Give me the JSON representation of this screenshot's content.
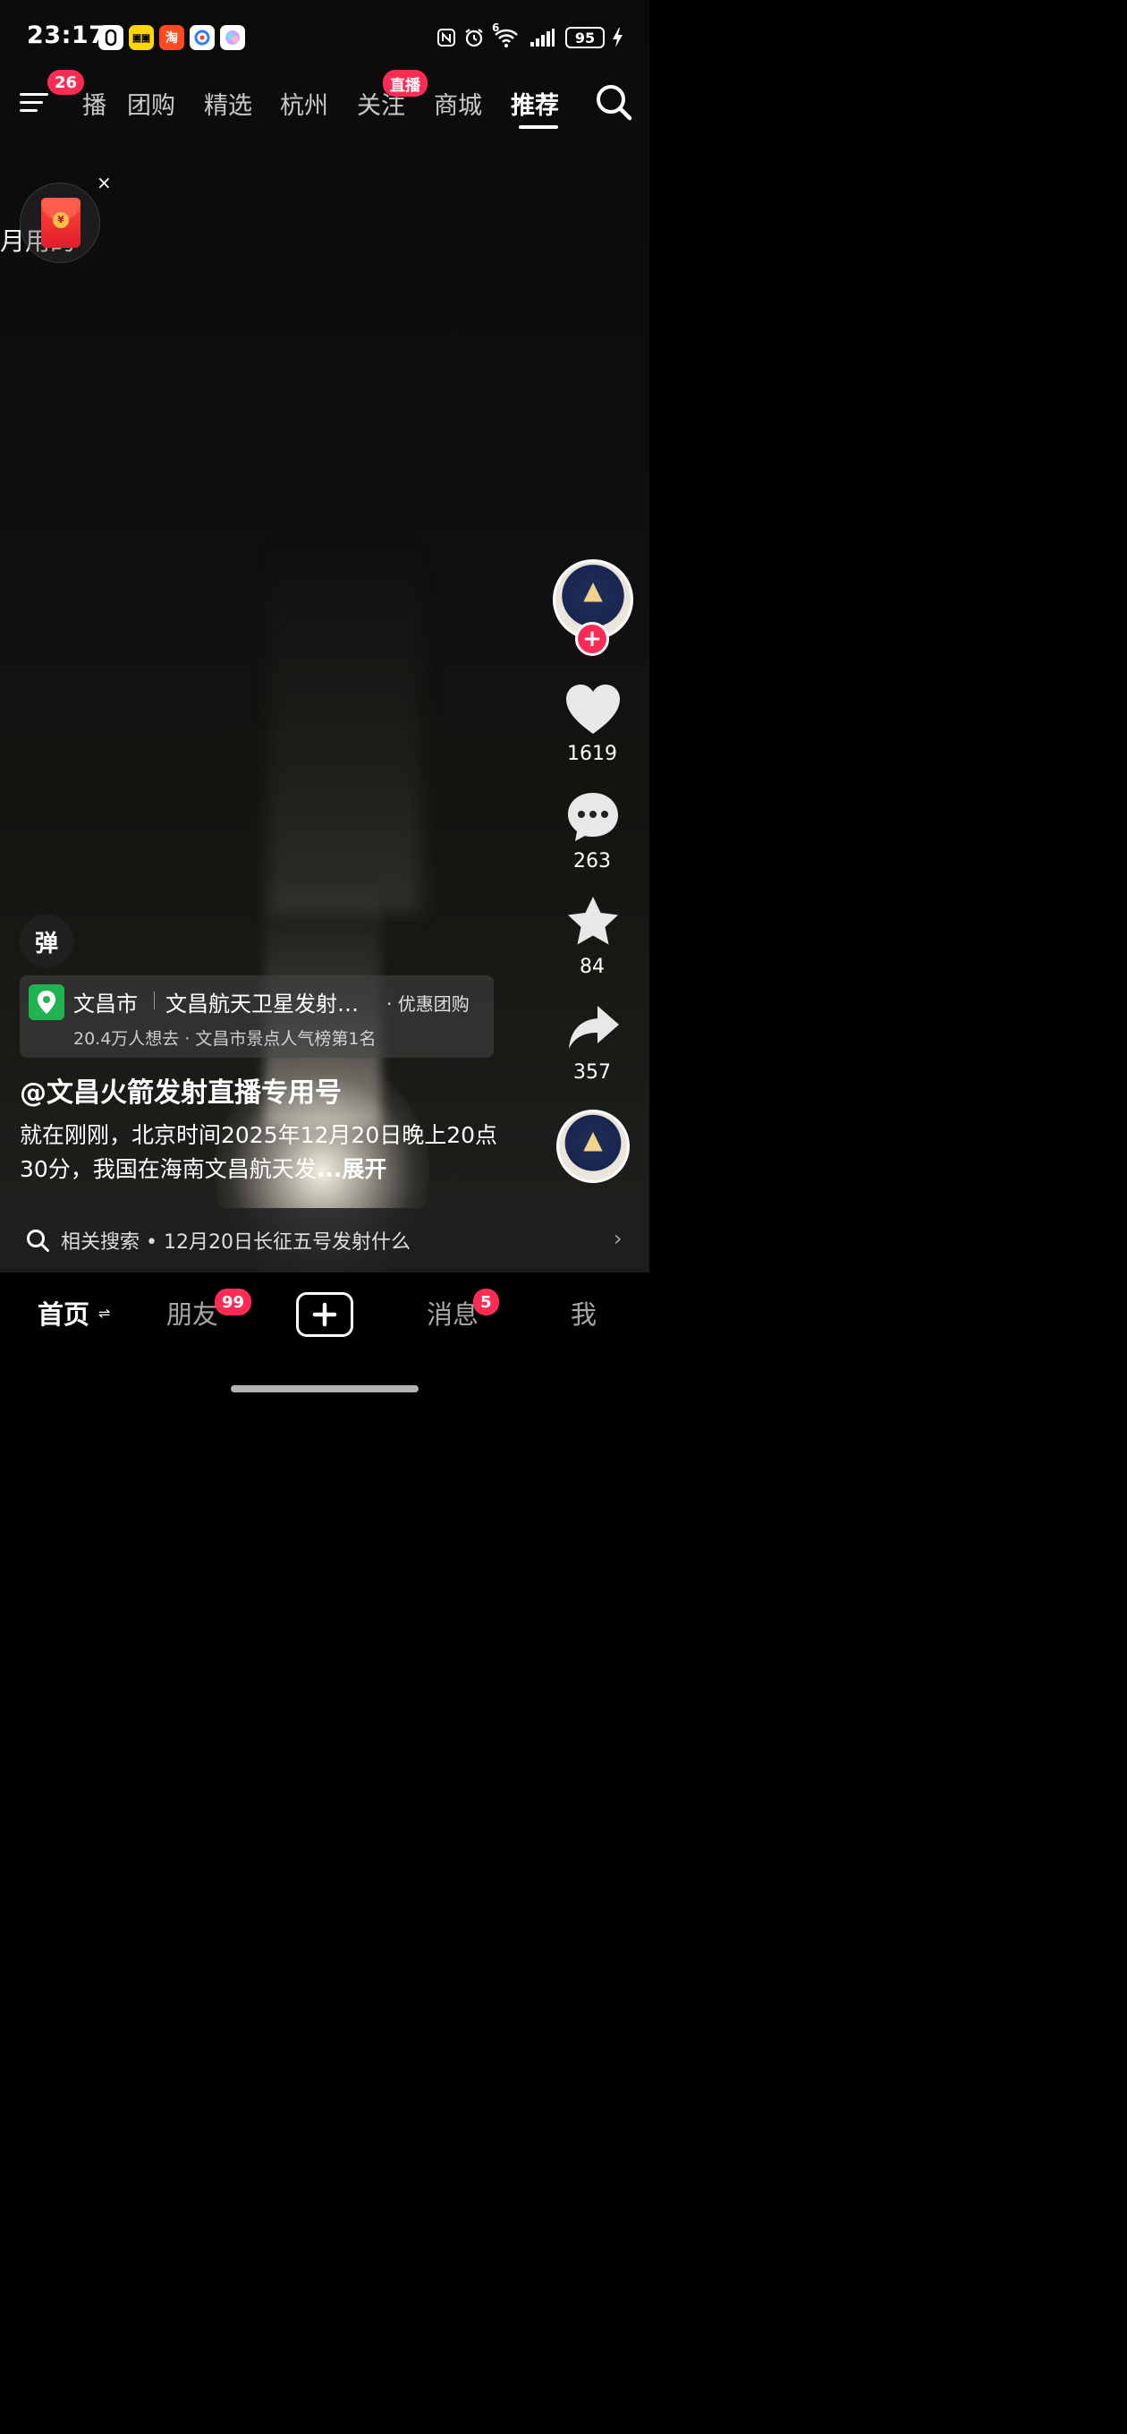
{
  "status_bar": {
    "time": "23:17",
    "apps": [
      "dji-icon",
      "meituan-icon",
      "taobao-icon",
      "gaode-icon",
      "gallery-icon"
    ],
    "meituan_label": "團團",
    "taobao_label": "淘",
    "battery": "95",
    "network": "6"
  },
  "top_nav": {
    "menu_badge": "26",
    "tabs": [
      "播",
      "团购",
      "精选",
      "杭州",
      "关注",
      "商城",
      "推荐"
    ],
    "follow_badge": "直播",
    "active_tab": "推荐"
  },
  "red_packet": {
    "partial_text": "月用的",
    "seal_label": "¥",
    "close_label": "×"
  },
  "actions": {
    "likes": "1619",
    "comments": "263",
    "favorites": "84",
    "shares": "357"
  },
  "danmu": {
    "label": "弹"
  },
  "poi": {
    "city": "文昌市",
    "name": "文昌航天卫星发射…",
    "deal": "· 优惠团购",
    "meta": "20.4万人想去 · 文昌市景点人气榜第1名"
  },
  "video": {
    "author": "@文昌火箭发射直播专用号",
    "caption": "就在刚刚，北京时间2025年12月20日晚上20点30分，我国在海南文昌航天发",
    "expand": "...展开"
  },
  "related_search": {
    "label": "相关搜索 • 12月20日长征五号发射什么"
  },
  "bottom_nav": {
    "home": "首页",
    "friends": "朋友",
    "friends_badge": "99",
    "messages": "消息",
    "messages_badge": "5",
    "me": "我"
  }
}
